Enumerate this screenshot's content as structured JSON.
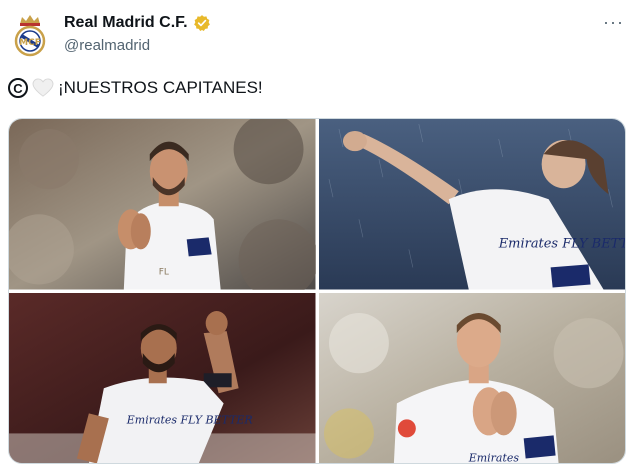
{
  "tweet": {
    "display_name": "Real Madrid C.F.",
    "handle": "@realmadrid",
    "more_label": "···",
    "text": "¡NUESTROS CAPITANES!",
    "copyright_symbol": "C",
    "emoji_icon": "white-heart-icon"
  },
  "colors": {
    "verified": "#e8b92a",
    "real_madrid_gold": "#c9a14a",
    "real_madrid_blue": "#1a3a8a",
    "text": "#0f1419",
    "secondary_text": "#536471"
  },
  "media": {
    "photos": [
      {
        "subject": "player applauding",
        "jersey_text": "Emirates FLY BETTER",
        "jersey_number_text": "FL"
      },
      {
        "subject": "player celebrating in rain",
        "jersey_text": "Emirates FLY BETTER"
      },
      {
        "subject": "player raising fist",
        "jersey_text": "Emirates FLY BETTER"
      },
      {
        "subject": "player applauding close-up",
        "jersey_text": "Emirates"
      }
    ]
  }
}
